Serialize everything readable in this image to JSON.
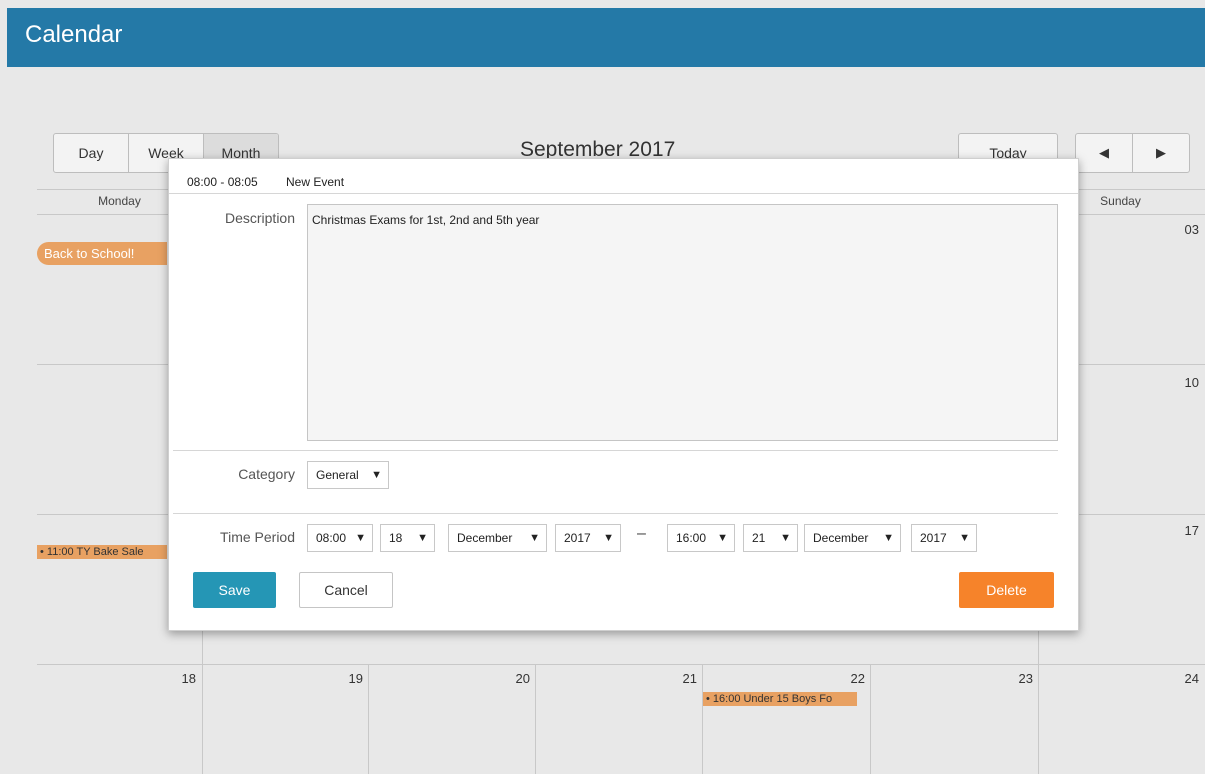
{
  "app": {
    "title": "Calendar"
  },
  "toolbar": {
    "views": [
      "Day",
      "Week",
      "Month"
    ],
    "active_view": "Month",
    "month_title": "September 2017",
    "today_label": "Today",
    "prev_icon": "◀",
    "next_icon": "▶"
  },
  "calendar": {
    "day_headers": [
      "Monday",
      "Sunday"
    ],
    "day_numbers_row1": [
      "03"
    ],
    "day_numbers_row2": [
      "10"
    ],
    "day_numbers_row3": [
      "17"
    ],
    "day_numbers_row4": [
      "18",
      "19",
      "20",
      "21",
      "22",
      "23",
      "24"
    ],
    "events": {
      "back_to_school": "Back to School!",
      "bake_sale": "• 11:00 TY Bake Sale",
      "boys_fixture": "• 16:00 Under 15 Boys Fo"
    },
    "event_color": "#e8a162"
  },
  "modal": {
    "time_range": "08:00 - 08:05",
    "title": "New Event",
    "description_label": "Description",
    "description_value": "Christmas Exams for 1st, 2nd and 5th year",
    "category_label": "Category",
    "category_value": "General",
    "time_period_label": "Time Period",
    "start": {
      "time": "08:00",
      "day": "18",
      "month": "December",
      "year": "2017"
    },
    "separator": "–",
    "end": {
      "time": "16:00",
      "day": "21",
      "month": "December",
      "year": "2017"
    },
    "dropdown_arrow": "▼",
    "save_label": "Save",
    "cancel_label": "Cancel",
    "delete_label": "Delete"
  }
}
